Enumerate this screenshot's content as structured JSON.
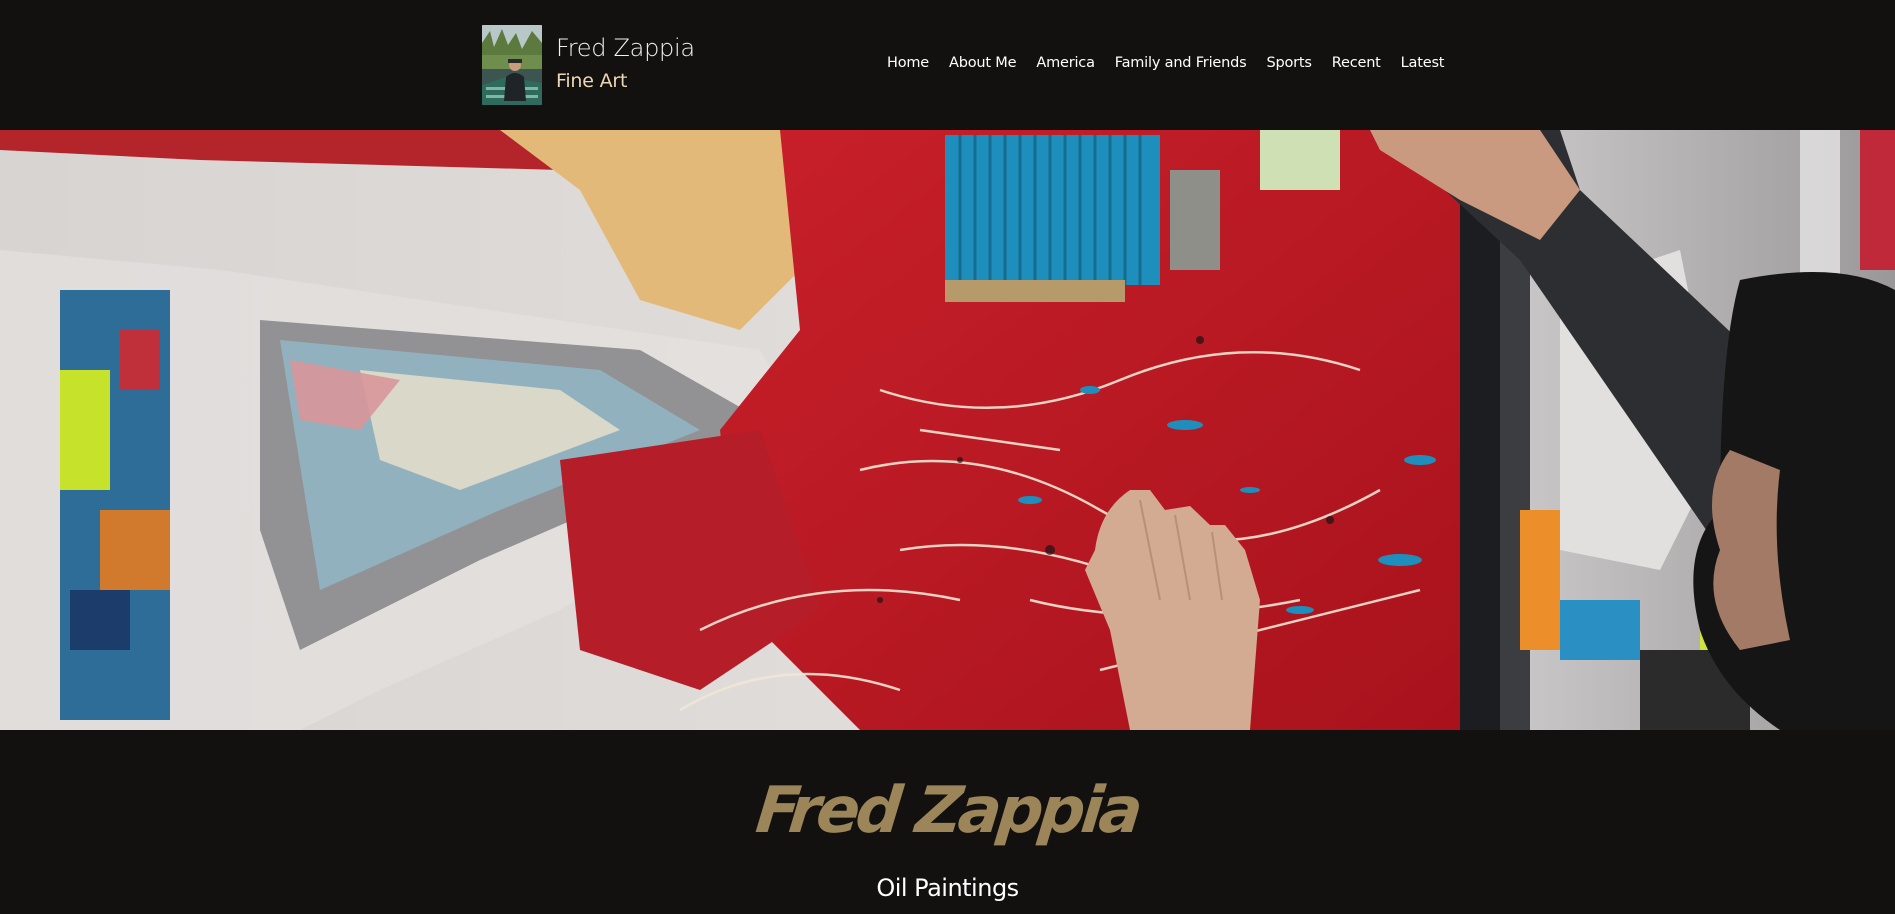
{
  "header": {
    "brand_name": "Fred Zappia",
    "brand_subtitle": "Fine Art",
    "logo_icon": "artist-portrait-thumbnail"
  },
  "nav": {
    "items": [
      {
        "label": "Home"
      },
      {
        "label": "About Me"
      },
      {
        "label": "America"
      },
      {
        "label": "Family and Friends"
      },
      {
        "label": "Sports"
      },
      {
        "label": "Recent"
      },
      {
        "label": "Latest"
      }
    ]
  },
  "hero": {
    "image_name": "artist-painting-banner"
  },
  "main": {
    "title": "Fred Zappia",
    "subtitle": "Oil Paintings"
  },
  "colors": {
    "background": "#121110",
    "accent_gold": "#9c8558",
    "subtitle_cream": "#ecd7b4",
    "nav_text": "#ffffff"
  }
}
